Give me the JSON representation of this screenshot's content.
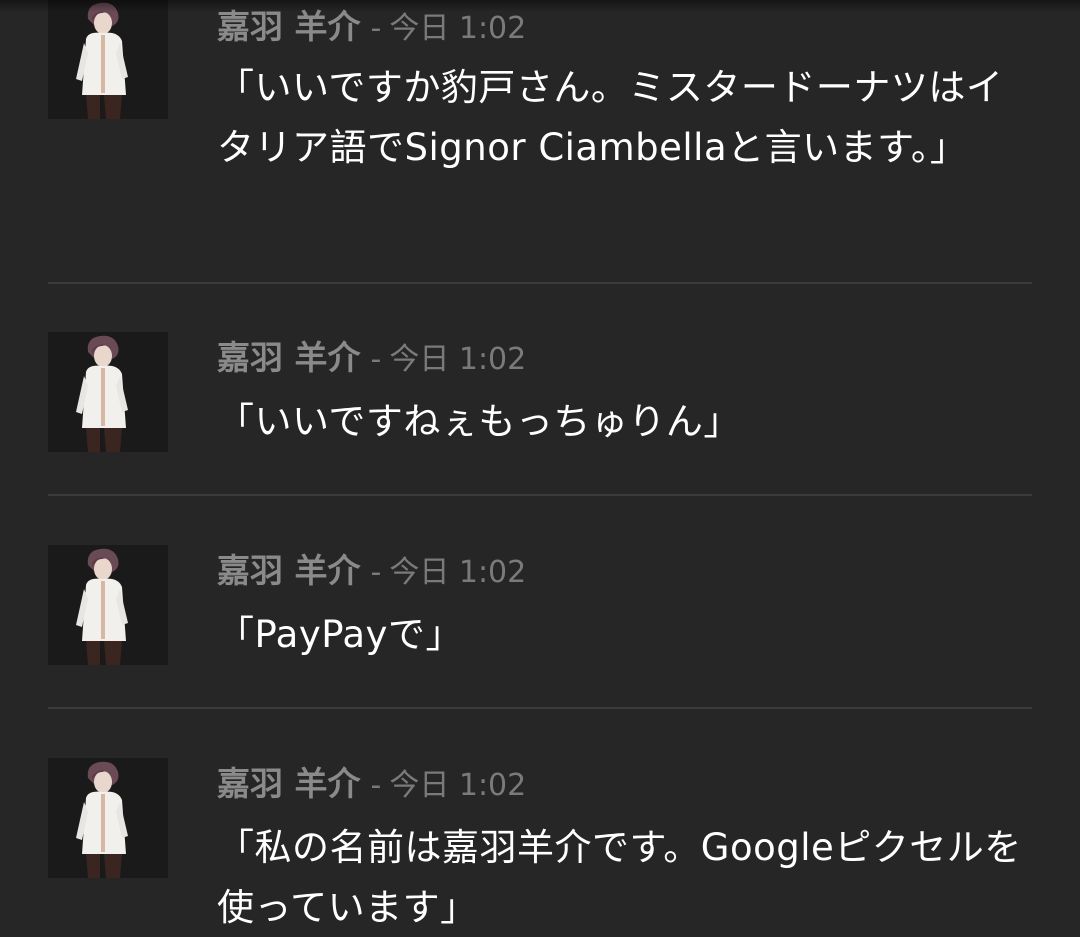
{
  "messages": [
    {
      "author": "嘉羽 羊介",
      "separator": "-",
      "time": "今日 1:02",
      "text": "「いいですか豹戸さん。ミスタードーナツはイタリア語でSignor Ciambellaと言います。」"
    },
    {
      "author": "嘉羽 羊介",
      "separator": "-",
      "time": "今日 1:02",
      "text": "「いいですねぇもっちゅりん」"
    },
    {
      "author": "嘉羽 羊介",
      "separator": "-",
      "time": "今日 1:02",
      "text": "「PayPayで」"
    },
    {
      "author": "嘉羽 羊介",
      "separator": "-",
      "time": "今日 1:02",
      "text": "「私の名前は嘉羽羊介です。Googleピクセルを使っています」"
    }
  ],
  "colors": {
    "background": "#262626",
    "author": "#8a8a8a",
    "timestamp": "#7a7a7a",
    "message_text": "#ffffff",
    "divider": "#3b3b3b",
    "avatar_background": "#1a1a1a"
  },
  "icons": {
    "avatar": "character-portrait-avatar"
  }
}
